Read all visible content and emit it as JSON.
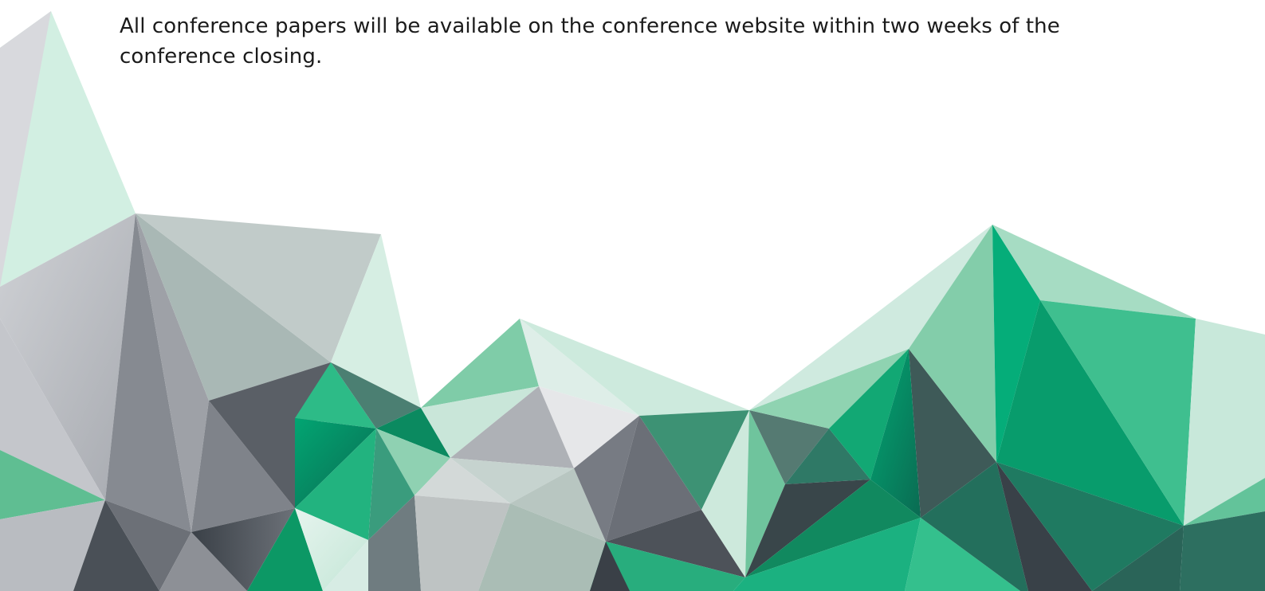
{
  "document": {
    "paragraph": "All conference papers will be available on the conference website within two weeks of the conference closing."
  },
  "decoration": {
    "icon": "low-poly-mountain-graphic",
    "colors": {
      "light_gray": "#d7d8dc",
      "mid_gray": "#8a8d93",
      "dark_slate": "#3f454c",
      "mint": "#d3ede2",
      "light_green": "#86cfac",
      "emerald": "#17b07c",
      "deep_green": "#087a5c"
    }
  }
}
